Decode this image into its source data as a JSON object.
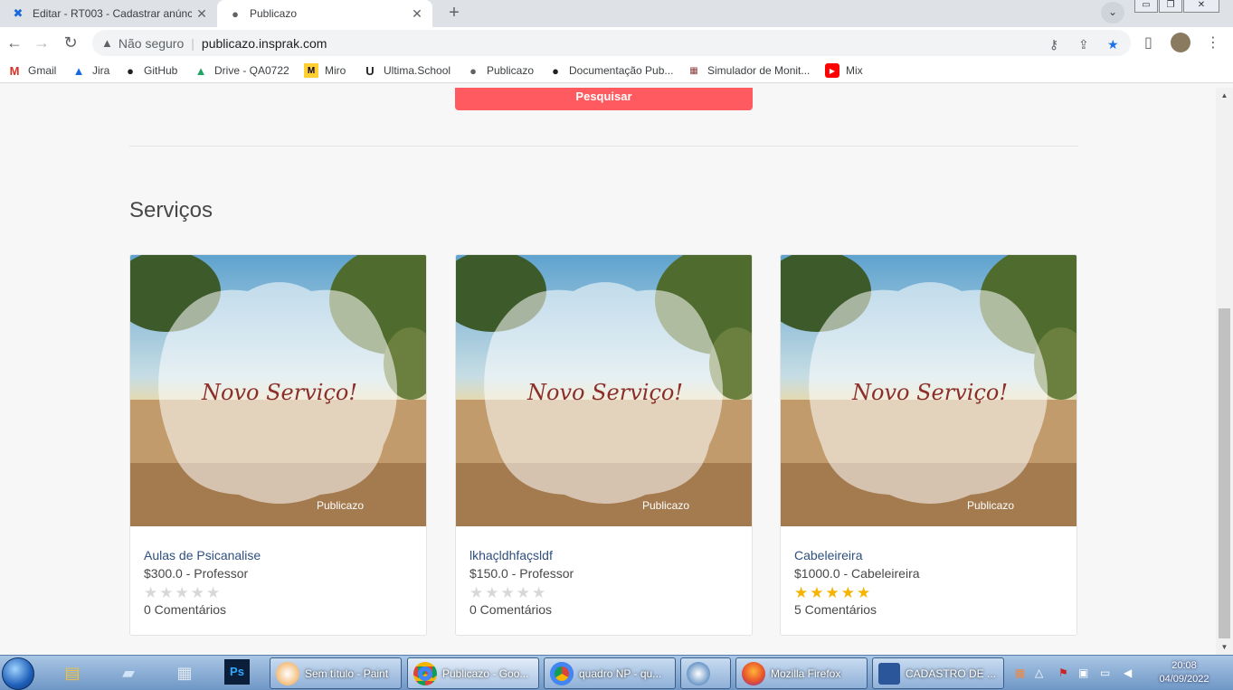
{
  "browser": {
    "tabs": [
      {
        "title": "Editar - RT003 - Cadastrar anúncio",
        "icon": "confluence-icon"
      },
      {
        "title": "Publicazo",
        "icon": "globe-icon"
      }
    ],
    "address": {
      "security_label": "Não seguro",
      "url": "publicazo.insprak.com"
    },
    "bookmarks": [
      {
        "label": "Gmail",
        "icon": "gmail-icon"
      },
      {
        "label": "Jira",
        "icon": "jira-icon"
      },
      {
        "label": "GitHub",
        "icon": "github-icon"
      },
      {
        "label": "Drive - QA0722",
        "icon": "drive-icon"
      },
      {
        "label": "Miro",
        "icon": "miro-icon"
      },
      {
        "label": "Ultima.School",
        "icon": "ultima-icon"
      },
      {
        "label": "Publicazo",
        "icon": "globe-icon"
      },
      {
        "label": "Documentação Pub...",
        "icon": "github-icon"
      },
      {
        "label": "Simulador de Monit...",
        "icon": "simulator-icon"
      },
      {
        "label": "Mix",
        "icon": "youtube-icon"
      }
    ]
  },
  "page": {
    "search_button": "Pesquisar",
    "section_title": "Serviços",
    "cards": [
      {
        "title": "Aulas de Psicanalise",
        "price": "$300.0 - Professor",
        "rating": 0,
        "comments": "0 Comentários",
        "image_title": "Novo Serviço!",
        "image_brand": "Publicazo"
      },
      {
        "title": "lkhaçldhfaçsldf",
        "price": "$150.0 - Professor",
        "rating": 0,
        "comments": "0 Comentários",
        "image_title": "Novo Serviço!",
        "image_brand": "Publicazo"
      },
      {
        "title": "Cabeleireira",
        "price": "$1000.0 - Cabeleireira",
        "rating": 5,
        "comments": "5 Comentários",
        "image_title": "Novo Serviço!",
        "image_brand": "Publicazo"
      }
    ]
  },
  "taskbar": {
    "tasks": [
      {
        "label": "Sem título - Paint"
      },
      {
        "label": "Publicazo - Goo..."
      },
      {
        "label": "quadro NP - qu..."
      },
      {
        "label": ""
      },
      {
        "label": "Mozilla Firefox"
      },
      {
        "label": "CADASTRO DE ..."
      }
    ],
    "time": "20:08",
    "date": "04/09/2022"
  },
  "colors": {
    "accent": "#ff5a5f",
    "star_on": "#f4b400",
    "star_off": "#d8d8d8",
    "link": "#2f4f7f"
  }
}
